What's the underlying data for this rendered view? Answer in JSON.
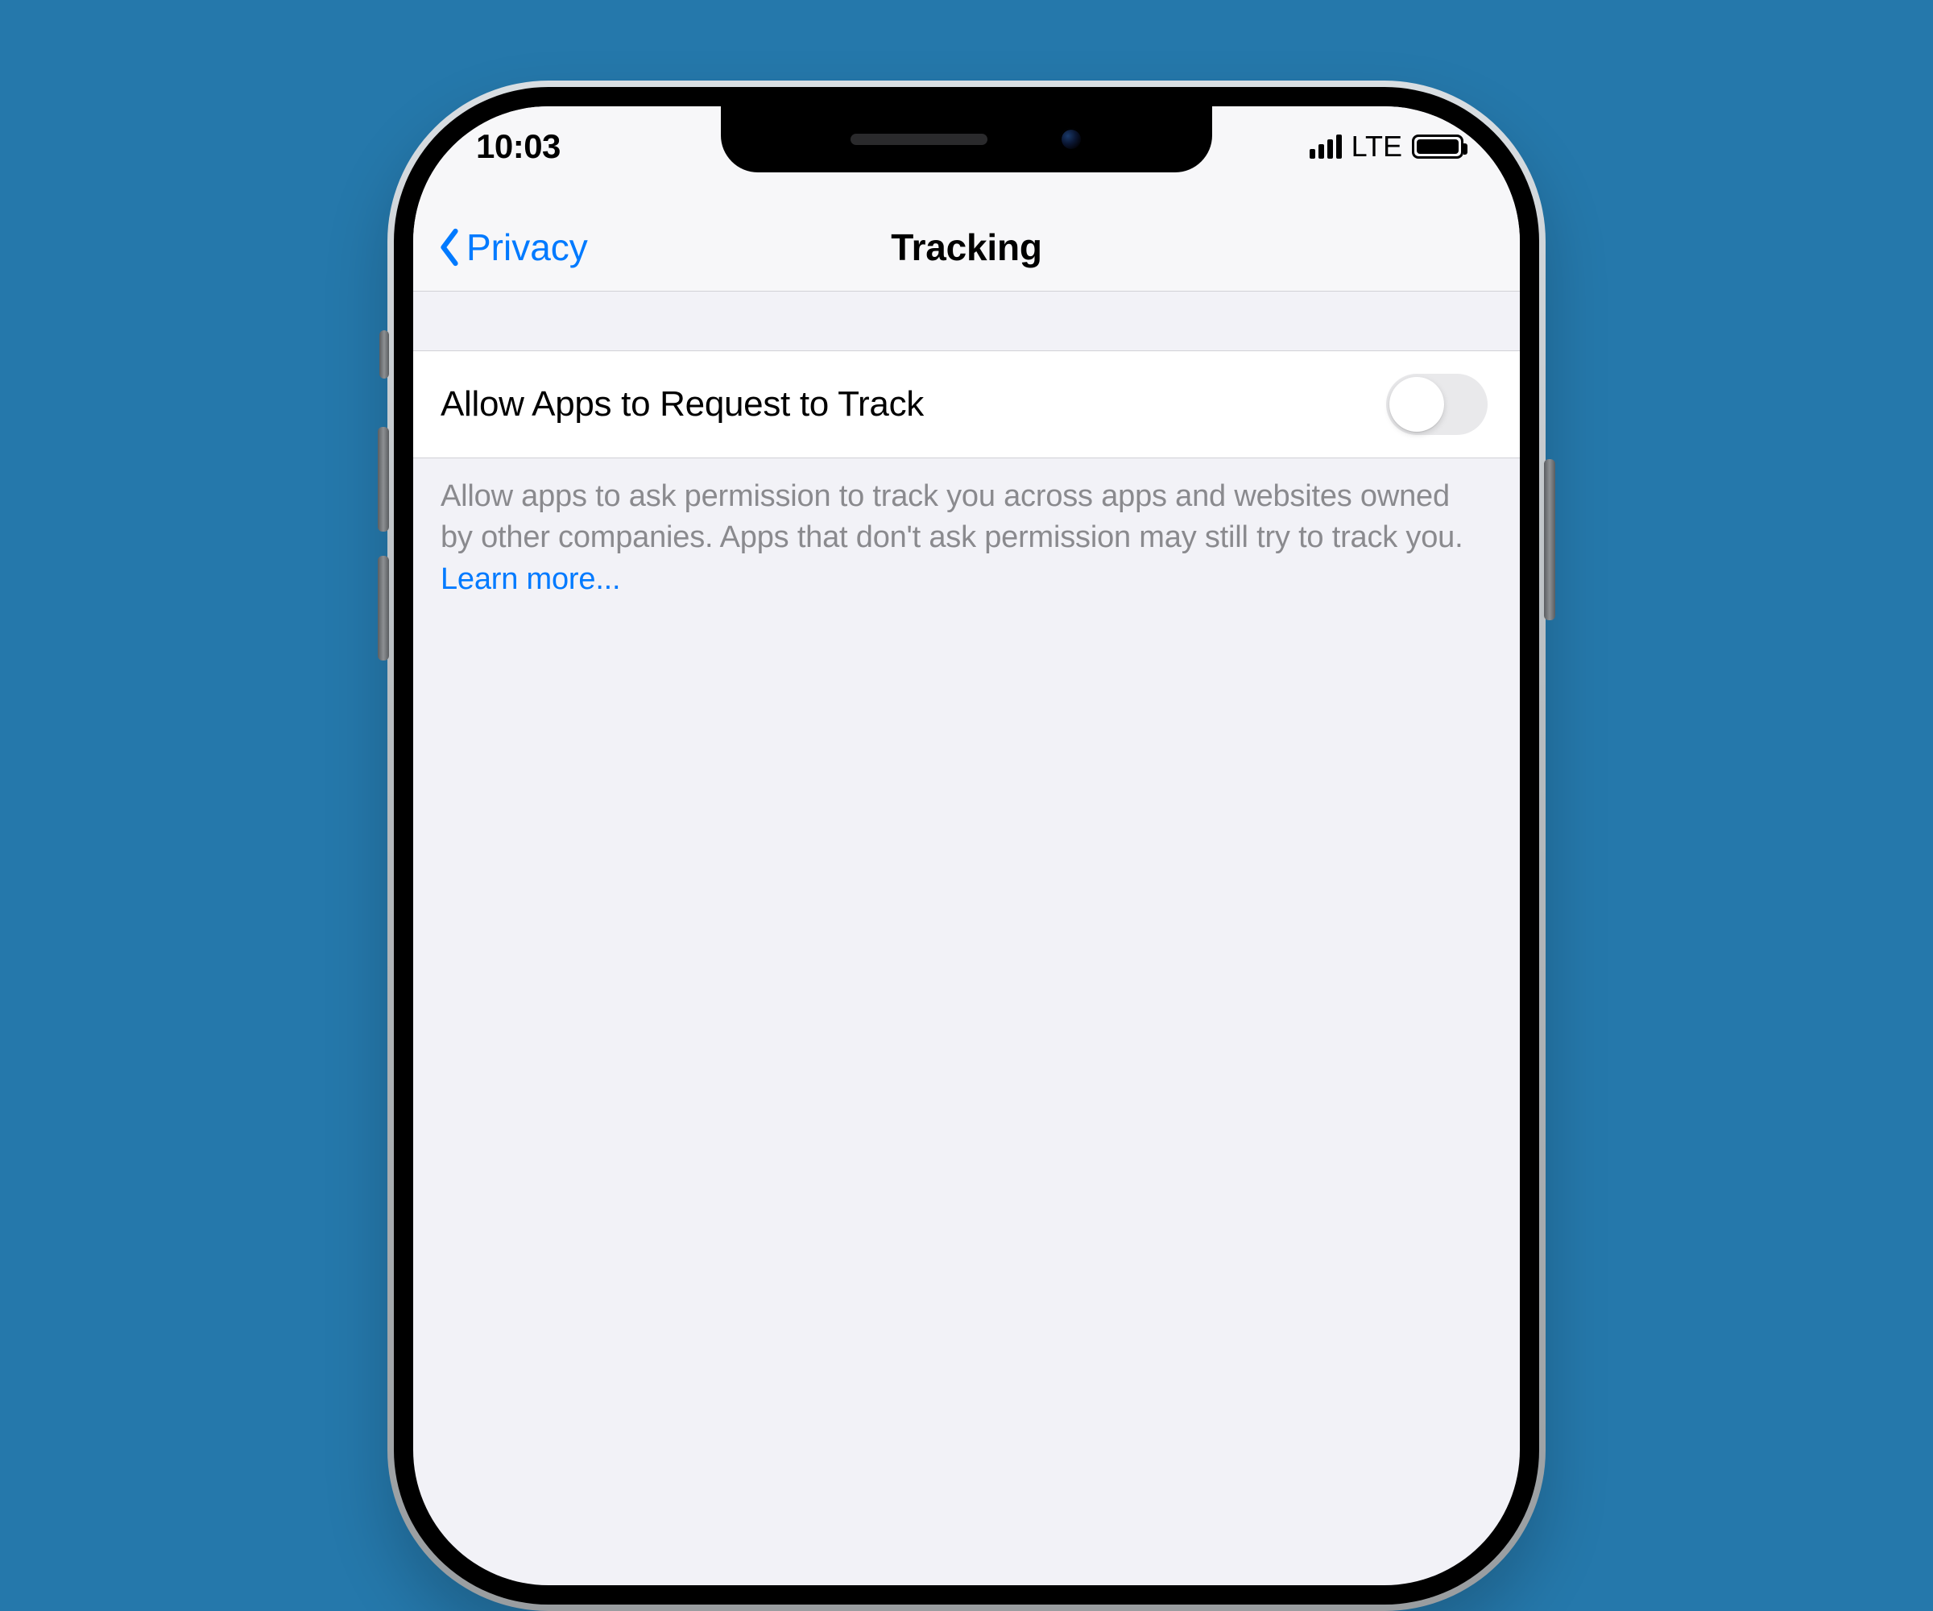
{
  "status": {
    "time": "10:03",
    "carrier": "LTE"
  },
  "nav": {
    "back_label": "Privacy",
    "title": "Tracking"
  },
  "toggle_row": {
    "label": "Allow Apps to Request to Track",
    "enabled": false
  },
  "footer": {
    "text": "Allow apps to ask permission to track you across apps and websites owned by other companies. Apps that don't ask permission may still try to track you. ",
    "learn_more": "Learn more..."
  }
}
